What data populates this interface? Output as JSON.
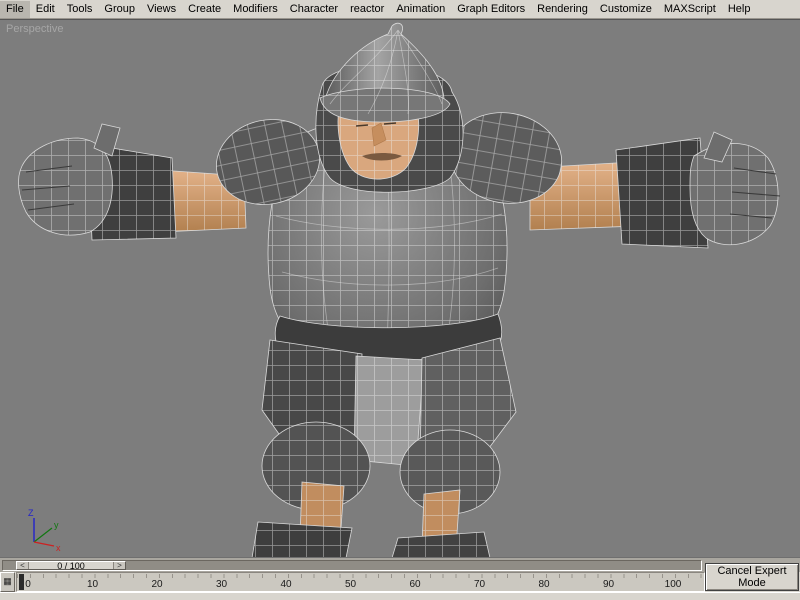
{
  "menu": {
    "items": [
      "File",
      "Edit",
      "Tools",
      "Group",
      "Views",
      "Create",
      "Modifiers",
      "Character",
      "reactor",
      "Animation",
      "Graph Editors",
      "Rendering",
      "Customize",
      "MAXScript",
      "Help"
    ]
  },
  "viewport": {
    "label": "Perspective",
    "content_description": "low-poly armored knight character in T-pose with wireframe overlay"
  },
  "axis_gizmo": {
    "x_label": "x",
    "y_label": "y",
    "z_label": "Z"
  },
  "timeline": {
    "handle_label": "0 / 100",
    "step_back": "<",
    "step_forward": ">",
    "current_frame": "0",
    "total_frames": "100",
    "ticks": [
      "0",
      "10",
      "20",
      "30",
      "40",
      "50",
      "60",
      "70",
      "80",
      "90",
      "100"
    ]
  },
  "controls": {
    "cancel_expert_mode": "Cancel Expert Mode"
  },
  "icons": {
    "curve_editor": "▦"
  },
  "colors": {
    "viewport_bg": "#7d7d7d",
    "menubar_bg": "#d8d5ce",
    "armor_gray": "#6e6e6e",
    "armor_dark": "#3f3f3f",
    "skin": "#d9a77e",
    "wireframe": "#e6e6e6",
    "axis_x": "#cc2222",
    "axis_y": "#117711",
    "axis_z": "#2222cc"
  }
}
